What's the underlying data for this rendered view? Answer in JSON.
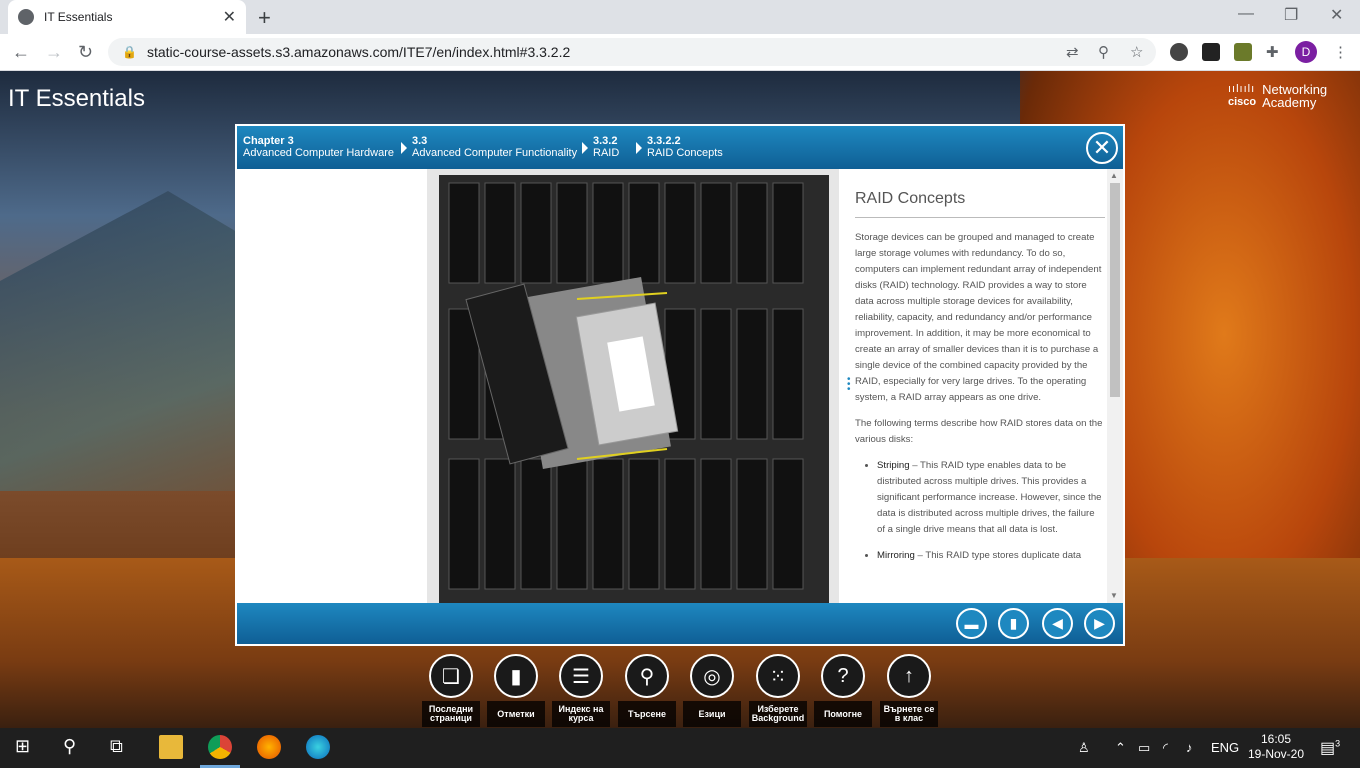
{
  "browser": {
    "tab_title": "IT Essentials",
    "url": "static-course-assets.s3.amazonaws.com/ITE7/en/index.html#3.3.2.2",
    "profile_initial": "D"
  },
  "page": {
    "brand": "IT Essentials",
    "cisco_word": "cisco",
    "cisco_line1": "Networking",
    "cisco_line2": "Academy"
  },
  "breadcrumbs": [
    {
      "num": "Chapter 3",
      "label": "Advanced Computer Hardware"
    },
    {
      "num": "3.3",
      "label": "Advanced Computer Functionality"
    },
    {
      "num": "3.3.2",
      "label": "RAID"
    },
    {
      "num": "3.3.2.2",
      "label": "RAID Concepts"
    }
  ],
  "article": {
    "title": "RAID Concepts",
    "p1": "Storage devices can be grouped and managed to create large storage volumes with redundancy. To do so, computers can implement redundant array of independent disks (RAID) technology. RAID provides a way to store data across multiple storage devices for availability, reliability, capacity, and redundancy and/or performance improvement. In addition, it may be more economical to create an array of smaller devices than it is to purchase a single device of the combined capacity provided by the RAID, especially for very large drives. To the operating system, a RAID array appears as one drive.",
    "p2": "The following terms describe how RAID stores data on the various disks:",
    "items": [
      {
        "term": "Striping",
        "text": " – This RAID type enables data to be distributed across multiple drives. This provides a significant performance increase. However, since the data is distributed across multiple drives, the failure of a single drive means that all data is lost."
      },
      {
        "term": "Mirroring",
        "text": " – This RAID type stores duplicate data"
      }
    ]
  },
  "dock": [
    {
      "label": "Последни страници",
      "icon": "recent-pages-icon"
    },
    {
      "label": "Отметки",
      "icon": "bookmark-icon"
    },
    {
      "label": "Индекс на курса",
      "icon": "index-icon"
    },
    {
      "label": "Търсене",
      "icon": "search-icon"
    },
    {
      "label": "Езици",
      "icon": "globe-icon"
    },
    {
      "label": "Изберете Background",
      "icon": "grid-icon"
    },
    {
      "label": "Помогне",
      "icon": "help-icon"
    },
    {
      "label": "Върнете се в клас",
      "icon": "up-arrow-icon"
    }
  ],
  "taskbar": {
    "lang": "ENG",
    "time": "16:05",
    "date": "19-Nov-20",
    "notifications": "3"
  }
}
